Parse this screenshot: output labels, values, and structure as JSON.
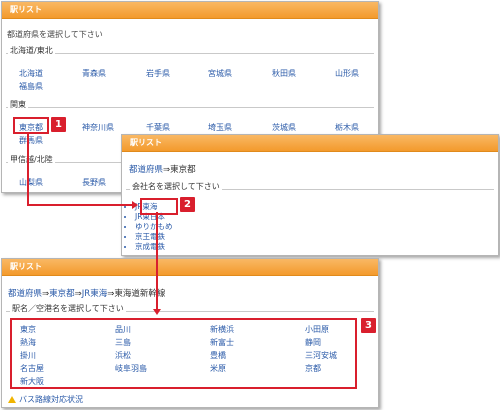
{
  "panel1": {
    "title": "駅リスト",
    "hint": "都道府県を選択して下さい",
    "regions": [
      {
        "name": "北海道/東北",
        "prefs": [
          "北海道",
          "青森県",
          "岩手県",
          "宮城県",
          "秋田県",
          "山形県",
          "福島県"
        ]
      },
      {
        "name": "関東",
        "prefs": [
          "東京都",
          "神奈川県",
          "千葉県",
          "埼玉県",
          "茨城県",
          "栃木県",
          "群馬県"
        ]
      },
      {
        "name": "甲信越/北陸",
        "prefs": [
          "山梨県",
          "長野県"
        ]
      }
    ]
  },
  "panel2": {
    "title": "駅リスト",
    "breadcrumb": {
      "root": "都道府県",
      "sep": "⇒",
      "current": "東京都"
    },
    "legend": "会社名を選択して下さい",
    "companies": [
      "JR東海",
      "JR東日本",
      "ゆりかもめ",
      "京王電鉄",
      "京成電鉄"
    ]
  },
  "panel3": {
    "title": "駅リスト",
    "breadcrumb": {
      "items": [
        "都道府県",
        "東京都",
        "JR東海"
      ],
      "sep": "⇒",
      "current": "東海道新幹線"
    },
    "legend": "駅名／空港名を選択して下さい",
    "stations": [
      "東京",
      "品川",
      "新横浜",
      "小田原",
      "熱海",
      "三島",
      "新富士",
      "静岡",
      "掛川",
      "浜松",
      "豊橋",
      "三河安城",
      "名古屋",
      "岐阜羽島",
      "米原",
      "京都",
      "新大阪"
    ],
    "footer": "バス路線対応状況"
  },
  "callouts": [
    "1",
    "2",
    "3"
  ],
  "colors": {
    "accent": "#f39a2c",
    "highlight": "#d91f2d",
    "link": "#2a5aa8",
    "warning": "#f0b400"
  },
  "icons": {
    "footer_icon": "warning-icon"
  }
}
